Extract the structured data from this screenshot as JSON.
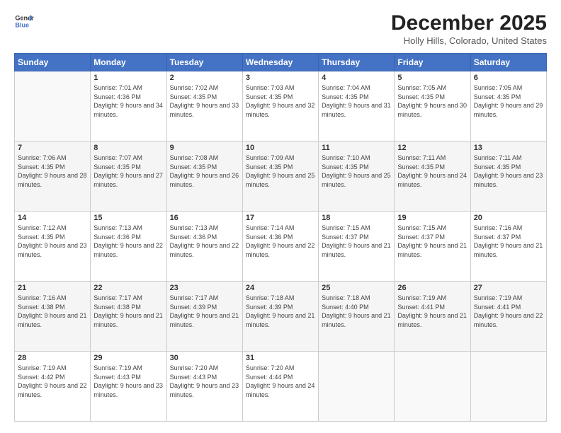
{
  "header": {
    "logo_line1": "General",
    "logo_line2": "Blue",
    "month": "December 2025",
    "location": "Holly Hills, Colorado, United States"
  },
  "days_of_week": [
    "Sunday",
    "Monday",
    "Tuesday",
    "Wednesday",
    "Thursday",
    "Friday",
    "Saturday"
  ],
  "weeks": [
    [
      {
        "day": "",
        "sunrise": "",
        "sunset": "",
        "daylight": ""
      },
      {
        "day": "1",
        "sunrise": "Sunrise: 7:01 AM",
        "sunset": "Sunset: 4:36 PM",
        "daylight": "Daylight: 9 hours and 34 minutes."
      },
      {
        "day": "2",
        "sunrise": "Sunrise: 7:02 AM",
        "sunset": "Sunset: 4:35 PM",
        "daylight": "Daylight: 9 hours and 33 minutes."
      },
      {
        "day": "3",
        "sunrise": "Sunrise: 7:03 AM",
        "sunset": "Sunset: 4:35 PM",
        "daylight": "Daylight: 9 hours and 32 minutes."
      },
      {
        "day": "4",
        "sunrise": "Sunrise: 7:04 AM",
        "sunset": "Sunset: 4:35 PM",
        "daylight": "Daylight: 9 hours and 31 minutes."
      },
      {
        "day": "5",
        "sunrise": "Sunrise: 7:05 AM",
        "sunset": "Sunset: 4:35 PM",
        "daylight": "Daylight: 9 hours and 30 minutes."
      },
      {
        "day": "6",
        "sunrise": "Sunrise: 7:05 AM",
        "sunset": "Sunset: 4:35 PM",
        "daylight": "Daylight: 9 hours and 29 minutes."
      }
    ],
    [
      {
        "day": "7",
        "sunrise": "Sunrise: 7:06 AM",
        "sunset": "Sunset: 4:35 PM",
        "daylight": "Daylight: 9 hours and 28 minutes."
      },
      {
        "day": "8",
        "sunrise": "Sunrise: 7:07 AM",
        "sunset": "Sunset: 4:35 PM",
        "daylight": "Daylight: 9 hours and 27 minutes."
      },
      {
        "day": "9",
        "sunrise": "Sunrise: 7:08 AM",
        "sunset": "Sunset: 4:35 PM",
        "daylight": "Daylight: 9 hours and 26 minutes."
      },
      {
        "day": "10",
        "sunrise": "Sunrise: 7:09 AM",
        "sunset": "Sunset: 4:35 PM",
        "daylight": "Daylight: 9 hours and 25 minutes."
      },
      {
        "day": "11",
        "sunrise": "Sunrise: 7:10 AM",
        "sunset": "Sunset: 4:35 PM",
        "daylight": "Daylight: 9 hours and 25 minutes."
      },
      {
        "day": "12",
        "sunrise": "Sunrise: 7:11 AM",
        "sunset": "Sunset: 4:35 PM",
        "daylight": "Daylight: 9 hours and 24 minutes."
      },
      {
        "day": "13",
        "sunrise": "Sunrise: 7:11 AM",
        "sunset": "Sunset: 4:35 PM",
        "daylight": "Daylight: 9 hours and 23 minutes."
      }
    ],
    [
      {
        "day": "14",
        "sunrise": "Sunrise: 7:12 AM",
        "sunset": "Sunset: 4:35 PM",
        "daylight": "Daylight: 9 hours and 23 minutes."
      },
      {
        "day": "15",
        "sunrise": "Sunrise: 7:13 AM",
        "sunset": "Sunset: 4:36 PM",
        "daylight": "Daylight: 9 hours and 22 minutes."
      },
      {
        "day": "16",
        "sunrise": "Sunrise: 7:13 AM",
        "sunset": "Sunset: 4:36 PM",
        "daylight": "Daylight: 9 hours and 22 minutes."
      },
      {
        "day": "17",
        "sunrise": "Sunrise: 7:14 AM",
        "sunset": "Sunset: 4:36 PM",
        "daylight": "Daylight: 9 hours and 22 minutes."
      },
      {
        "day": "18",
        "sunrise": "Sunrise: 7:15 AM",
        "sunset": "Sunset: 4:37 PM",
        "daylight": "Daylight: 9 hours and 21 minutes."
      },
      {
        "day": "19",
        "sunrise": "Sunrise: 7:15 AM",
        "sunset": "Sunset: 4:37 PM",
        "daylight": "Daylight: 9 hours and 21 minutes."
      },
      {
        "day": "20",
        "sunrise": "Sunrise: 7:16 AM",
        "sunset": "Sunset: 4:37 PM",
        "daylight": "Daylight: 9 hours and 21 minutes."
      }
    ],
    [
      {
        "day": "21",
        "sunrise": "Sunrise: 7:16 AM",
        "sunset": "Sunset: 4:38 PM",
        "daylight": "Daylight: 9 hours and 21 minutes."
      },
      {
        "day": "22",
        "sunrise": "Sunrise: 7:17 AM",
        "sunset": "Sunset: 4:38 PM",
        "daylight": "Daylight: 9 hours and 21 minutes."
      },
      {
        "day": "23",
        "sunrise": "Sunrise: 7:17 AM",
        "sunset": "Sunset: 4:39 PM",
        "daylight": "Daylight: 9 hours and 21 minutes."
      },
      {
        "day": "24",
        "sunrise": "Sunrise: 7:18 AM",
        "sunset": "Sunset: 4:39 PM",
        "daylight": "Daylight: 9 hours and 21 minutes."
      },
      {
        "day": "25",
        "sunrise": "Sunrise: 7:18 AM",
        "sunset": "Sunset: 4:40 PM",
        "daylight": "Daylight: 9 hours and 21 minutes."
      },
      {
        "day": "26",
        "sunrise": "Sunrise: 7:19 AM",
        "sunset": "Sunset: 4:41 PM",
        "daylight": "Daylight: 9 hours and 21 minutes."
      },
      {
        "day": "27",
        "sunrise": "Sunrise: 7:19 AM",
        "sunset": "Sunset: 4:41 PM",
        "daylight": "Daylight: 9 hours and 22 minutes."
      }
    ],
    [
      {
        "day": "28",
        "sunrise": "Sunrise: 7:19 AM",
        "sunset": "Sunset: 4:42 PM",
        "daylight": "Daylight: 9 hours and 22 minutes."
      },
      {
        "day": "29",
        "sunrise": "Sunrise: 7:19 AM",
        "sunset": "Sunset: 4:43 PM",
        "daylight": "Daylight: 9 hours and 23 minutes."
      },
      {
        "day": "30",
        "sunrise": "Sunrise: 7:20 AM",
        "sunset": "Sunset: 4:43 PM",
        "daylight": "Daylight: 9 hours and 23 minutes."
      },
      {
        "day": "31",
        "sunrise": "Sunrise: 7:20 AM",
        "sunset": "Sunset: 4:44 PM",
        "daylight": "Daylight: 9 hours and 24 minutes."
      },
      {
        "day": "",
        "sunrise": "",
        "sunset": "",
        "daylight": ""
      },
      {
        "day": "",
        "sunrise": "",
        "sunset": "",
        "daylight": ""
      },
      {
        "day": "",
        "sunrise": "",
        "sunset": "",
        "daylight": ""
      }
    ]
  ]
}
